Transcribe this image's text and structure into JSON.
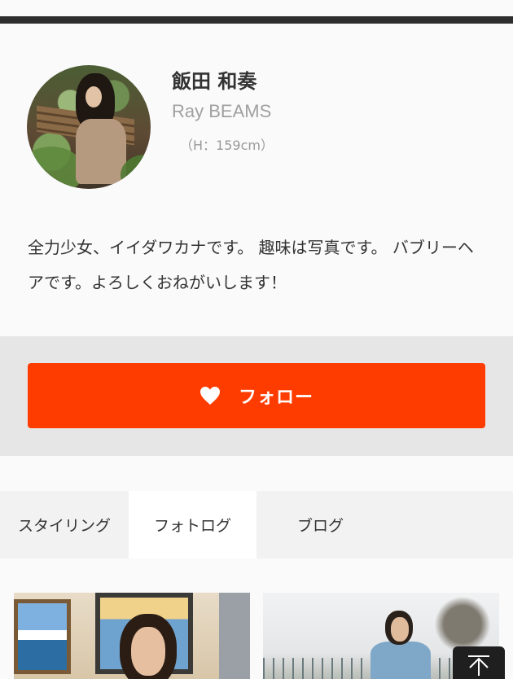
{
  "profile": {
    "name": "飯田 和奏",
    "brand": "Ray BEAMS",
    "height": "（H：159cm）",
    "bio": "全力少女、イイダワカナです。 趣味は写真です。 バブリーヘアです。よろしくおねがいします！"
  },
  "follow": {
    "label": "フォロー",
    "icon": "heart-icon",
    "color": "#ff3c00"
  },
  "tabs": [
    {
      "label": "スタイリング",
      "active": false
    },
    {
      "label": "フォトログ",
      "active": true
    },
    {
      "label": "ブログ",
      "active": false
    }
  ],
  "scroll_top": {
    "icon": "arrow-up-icon"
  }
}
